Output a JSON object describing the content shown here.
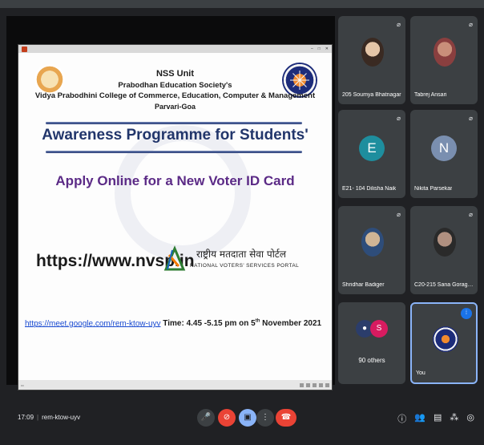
{
  "slide": {
    "nss": "NSS Unit",
    "society": "Prabodhan Education Society's",
    "college": "Vidya Prabodhini College of Commerce, Education, Computer & Management",
    "place": "Parvari-Goa",
    "programme": "Awareness Programme for Students'",
    "apply": "Apply Online for a New Voter ID Card",
    "url": "https://www.nvsp.in",
    "nvsp_hindi": "राष्ट्रीय मतदाता सेवा पोर्टल",
    "nvsp_english": "NATIONAL VOTERS' SERVICES PORTAL",
    "meet_link": "https://meet.google.com/rem-ktow-uyv",
    "meet_time_pre": "Time: 4.45 -5.15 pm  on 5",
    "meet_time_sup": "th",
    "meet_time_post": " November 2021"
  },
  "tiles": [
    {
      "name": "205 Soumya Bhatnagar"
    },
    {
      "name": "Tabrej Ansari"
    },
    {
      "name": "E21- 104 Dilisha Naik",
      "letter": "E",
      "color": "#1e8e9e"
    },
    {
      "name": "Nikita Parsekar",
      "letter": "N",
      "color": "#7a8fb0"
    },
    {
      "name": "Shridhar Badiger"
    },
    {
      "name": "C20-215 Sana Goragun..."
    },
    {
      "name": "90 others",
      "letter": "S",
      "color": "#d81b60"
    },
    {
      "name": "You"
    }
  ],
  "bottom": {
    "time": "17:09",
    "code": "rem-ktow-uyv"
  }
}
